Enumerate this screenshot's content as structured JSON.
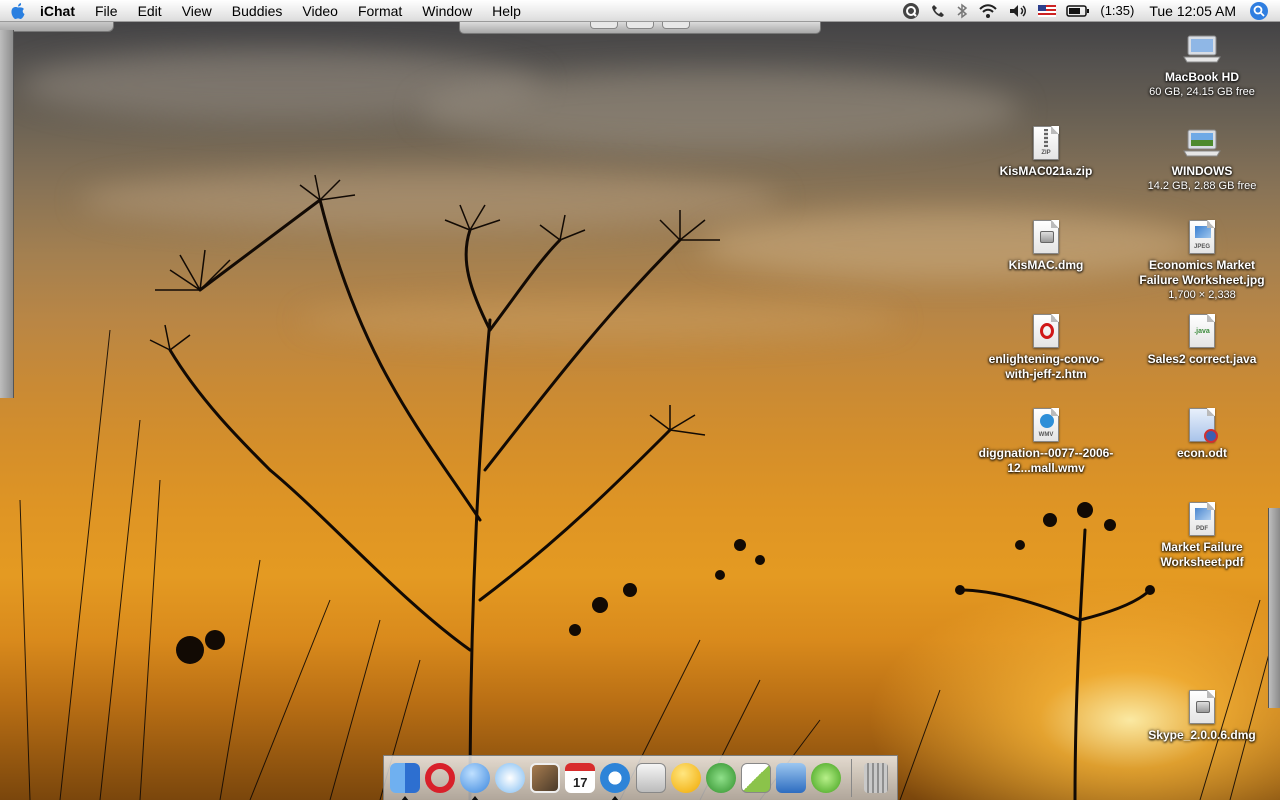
{
  "menubar": {
    "app_name": "iChat",
    "menus": [
      "File",
      "Edit",
      "View",
      "Buddies",
      "Video",
      "Format",
      "Window",
      "Help"
    ],
    "battery_time": "(1:35)",
    "clock": "Tue 12:05 AM",
    "status_icons": [
      "quicksilver-icon",
      "phone-icon",
      "bluetooth-icon",
      "wifi-icon",
      "volume-icon",
      "us-flag-icon",
      "battery-icon",
      "spotlight-icon"
    ]
  },
  "desktop": {
    "icons": [
      {
        "label": "MacBook HD",
        "sub": "60 GB, 24.15 GB free",
        "kind": "laptop-drive-icon"
      },
      {
        "label": "KisMAC021a.zip",
        "sub": "",
        "kind": "zip-file-icon",
        "tag": "ZIP"
      },
      {
        "label": "WINDOWS",
        "sub": "14.2 GB, 2.88 GB free",
        "kind": "windows-drive-icon"
      },
      {
        "label": "KisMAC.dmg",
        "sub": "",
        "kind": "disk-image-icon"
      },
      {
        "label": "Economics Market Failure Worksheet.jpg",
        "sub": "1,700 × 2,338",
        "kind": "jpeg-file-icon",
        "tag": "JPEG"
      },
      {
        "label": "enlightening-convo-with-jeff-z.htm",
        "sub": "",
        "kind": "opera-html-file-icon"
      },
      {
        "label": "Sales2 correct.java",
        "sub": "",
        "kind": "java-file-icon",
        "tag": ".java"
      },
      {
        "label": "diggnation--0077--2006-12...mall.wmv",
        "sub": "",
        "kind": "wmv-file-icon",
        "tag": "WMV"
      },
      {
        "label": "econ.odt",
        "sub": "",
        "kind": "odt-file-icon"
      },
      {
        "label": "Market Failure Worksheet.pdf",
        "sub": "",
        "kind": "pdf-file-icon",
        "tag": "PDF"
      },
      {
        "label": "Skype_2.0.0.6.dmg",
        "sub": "",
        "kind": "disk-image-icon"
      }
    ]
  },
  "dock": {
    "items": [
      {
        "name": "finder-icon",
        "color": "#4a8fe0",
        "running": true
      },
      {
        "name": "opera-icon",
        "color": "#d8202a",
        "running": false
      },
      {
        "name": "ichat-icon",
        "color": "#5aa6ee",
        "running": true
      },
      {
        "name": "itunes-icon",
        "color": "#6fb2f0",
        "running": false
      },
      {
        "name": "iphoto-icon",
        "color": "#8a6a48",
        "running": false
      },
      {
        "name": "ical-icon",
        "color": "#ffffff",
        "running": false,
        "text": "17"
      },
      {
        "name": "quicktime-icon",
        "color": "#3a8ad8",
        "running": true
      },
      {
        "name": "boot-camp-icon",
        "color": "#d0d0d0",
        "running": false
      },
      {
        "name": "adium-icon",
        "color": "#f4c21c",
        "running": false
      },
      {
        "name": "messenger-icon",
        "color": "#3fa83a",
        "running": false
      },
      {
        "name": "textedit-icon",
        "color": "#7bb84a",
        "running": false
      },
      {
        "name": "xcode-icon",
        "color": "#3d78c4",
        "running": false
      },
      {
        "name": "dreamweaver-icon",
        "color": "#5bbf2a",
        "running": false
      },
      {
        "name": "trash-icon",
        "color": "#9a9a9a",
        "running": false
      }
    ]
  }
}
